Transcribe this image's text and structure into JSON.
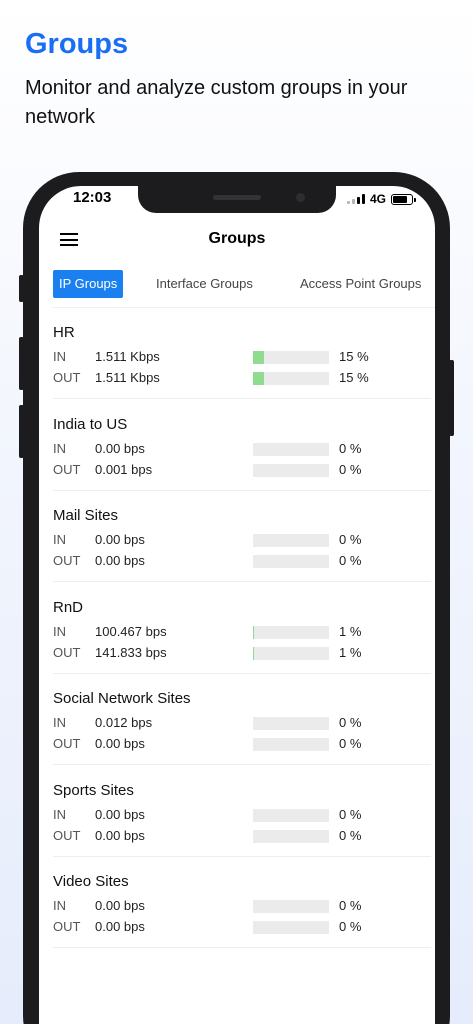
{
  "promo": {
    "title": "Groups",
    "subtitle": "Monitor and analyze custom groups in your network"
  },
  "status_bar": {
    "time": "12:03",
    "network": "4G"
  },
  "header": {
    "title": "Groups"
  },
  "tabs": [
    {
      "label": "IP Groups",
      "active": true
    },
    {
      "label": "Interface Groups",
      "active": false
    },
    {
      "label": "Access Point Groups",
      "active": false
    }
  ],
  "groups": [
    {
      "name": "HR",
      "in": {
        "label": "IN",
        "value": "1.511 Kbps",
        "percent": 15,
        "percent_label": "15 %"
      },
      "out": {
        "label": "OUT",
        "value": "1.511 Kbps",
        "percent": 15,
        "percent_label": "15 %"
      }
    },
    {
      "name": "India to US",
      "in": {
        "label": "IN",
        "value": "0.00 bps",
        "percent": 0,
        "percent_label": "0 %"
      },
      "out": {
        "label": "OUT",
        "value": "0.001 bps",
        "percent": 0,
        "percent_label": "0 %"
      }
    },
    {
      "name": "Mail Sites",
      "in": {
        "label": "IN",
        "value": "0.00 bps",
        "percent": 0,
        "percent_label": "0 %"
      },
      "out": {
        "label": "OUT",
        "value": "0.00 bps",
        "percent": 0,
        "percent_label": "0 %"
      }
    },
    {
      "name": "RnD",
      "in": {
        "label": "IN",
        "value": "100.467 bps",
        "percent": 1,
        "percent_label": "1 %"
      },
      "out": {
        "label": "OUT",
        "value": "141.833 bps",
        "percent": 1,
        "percent_label": "1 %"
      }
    },
    {
      "name": "Social Network Sites",
      "in": {
        "label": "IN",
        "value": "0.012 bps",
        "percent": 0,
        "percent_label": "0 %"
      },
      "out": {
        "label": "OUT",
        "value": "0.00 bps",
        "percent": 0,
        "percent_label": "0 %"
      }
    },
    {
      "name": "Sports Sites",
      "in": {
        "label": "IN",
        "value": "0.00 bps",
        "percent": 0,
        "percent_label": "0 %"
      },
      "out": {
        "label": "OUT",
        "value": "0.00 bps",
        "percent": 0,
        "percent_label": "0 %"
      }
    },
    {
      "name": "Video Sites",
      "in": {
        "label": "IN",
        "value": "0.00 bps",
        "percent": 0,
        "percent_label": "0 %"
      },
      "out": {
        "label": "OUT",
        "value": "0.00 bps",
        "percent": 0,
        "percent_label": "0 %"
      }
    }
  ],
  "colors": {
    "accent": "#1a6ef5",
    "tab_active": "#1a80f0",
    "bar_fill": "#8fdc90",
    "bar_track": "#ebebeb"
  }
}
